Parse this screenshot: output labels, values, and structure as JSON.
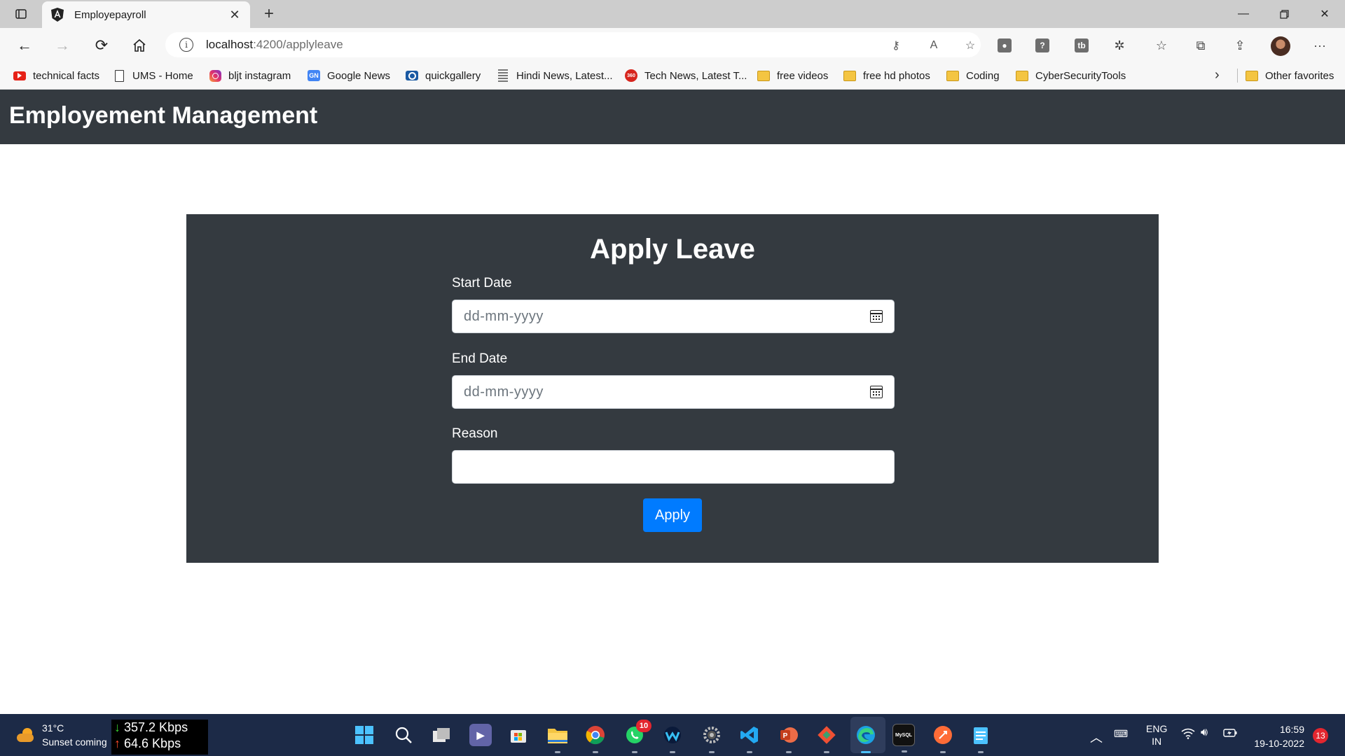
{
  "browser": {
    "tab_title": "Employepayroll",
    "url_host": "localhost",
    "url_path": ":4200/applyleave",
    "bookmarks": [
      {
        "label": "technical facts",
        "icon": "youtube-icon"
      },
      {
        "label": "UMS - Home",
        "icon": "page-icon"
      },
      {
        "label": "bljt instagram",
        "icon": "instagram-icon"
      },
      {
        "label": "Google News",
        "icon": "google-news-icon"
      },
      {
        "label": "quickgallery",
        "icon": "camera-icon"
      },
      {
        "label": "Hindi News, Latest...",
        "icon": "news-icon"
      },
      {
        "label": "Tech News, Latest T...",
        "icon": "ndtv-icon"
      },
      {
        "label": "free videos",
        "icon": "folder-icon"
      },
      {
        "label": "free hd photos",
        "icon": "folder-icon"
      },
      {
        "label": "Coding",
        "icon": "folder-icon"
      },
      {
        "label": "CyberSecurityTools",
        "icon": "folder-icon"
      }
    ],
    "other_favorites": "Other favorites"
  },
  "app": {
    "title": "Employement Management"
  },
  "form": {
    "title": "Apply Leave",
    "start_date_label": "Start Date",
    "start_date_placeholder": "dd-mm-yyyy",
    "end_date_label": "End Date",
    "end_date_placeholder": "dd-mm-yyyy",
    "reason_label": "Reason",
    "reason_value": "",
    "apply_label": "Apply"
  },
  "taskbar": {
    "temperature": "31°C",
    "weather_text": "Sunset coming",
    "download_speed": "357.2 Kbps",
    "upload_speed": "64.6 Kbps",
    "whatsapp_badge": "10",
    "language_top": "ENG",
    "language_bottom": "IN",
    "time": "16:59",
    "date": "19-10-2022",
    "notification_count": "13"
  },
  "colors": {
    "navbar": "#343a40",
    "card": "#343a40",
    "primary_button": "#007bff",
    "taskbar": "#1c2a47"
  }
}
